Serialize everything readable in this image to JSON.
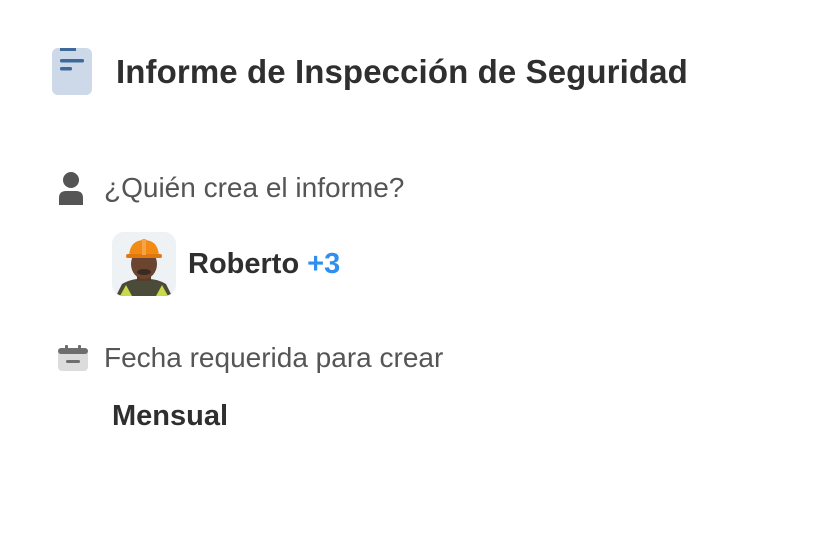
{
  "header": {
    "title": "Informe de Inspección de Seguridad",
    "icon": "document-icon"
  },
  "fields": {
    "creator": {
      "label": "¿Quién crea el informe?",
      "icon": "person-icon",
      "name": "Roberto",
      "extra": "+3"
    },
    "due_date": {
      "label": "Fecha requerida para crear",
      "icon": "calendar-icon",
      "value": "Mensual"
    }
  },
  "colors": {
    "accent": "#2f8ff0",
    "icon_blue": "#3e6a9a",
    "icon_bg": "#cdd9e8",
    "label_gray": "#555555"
  }
}
